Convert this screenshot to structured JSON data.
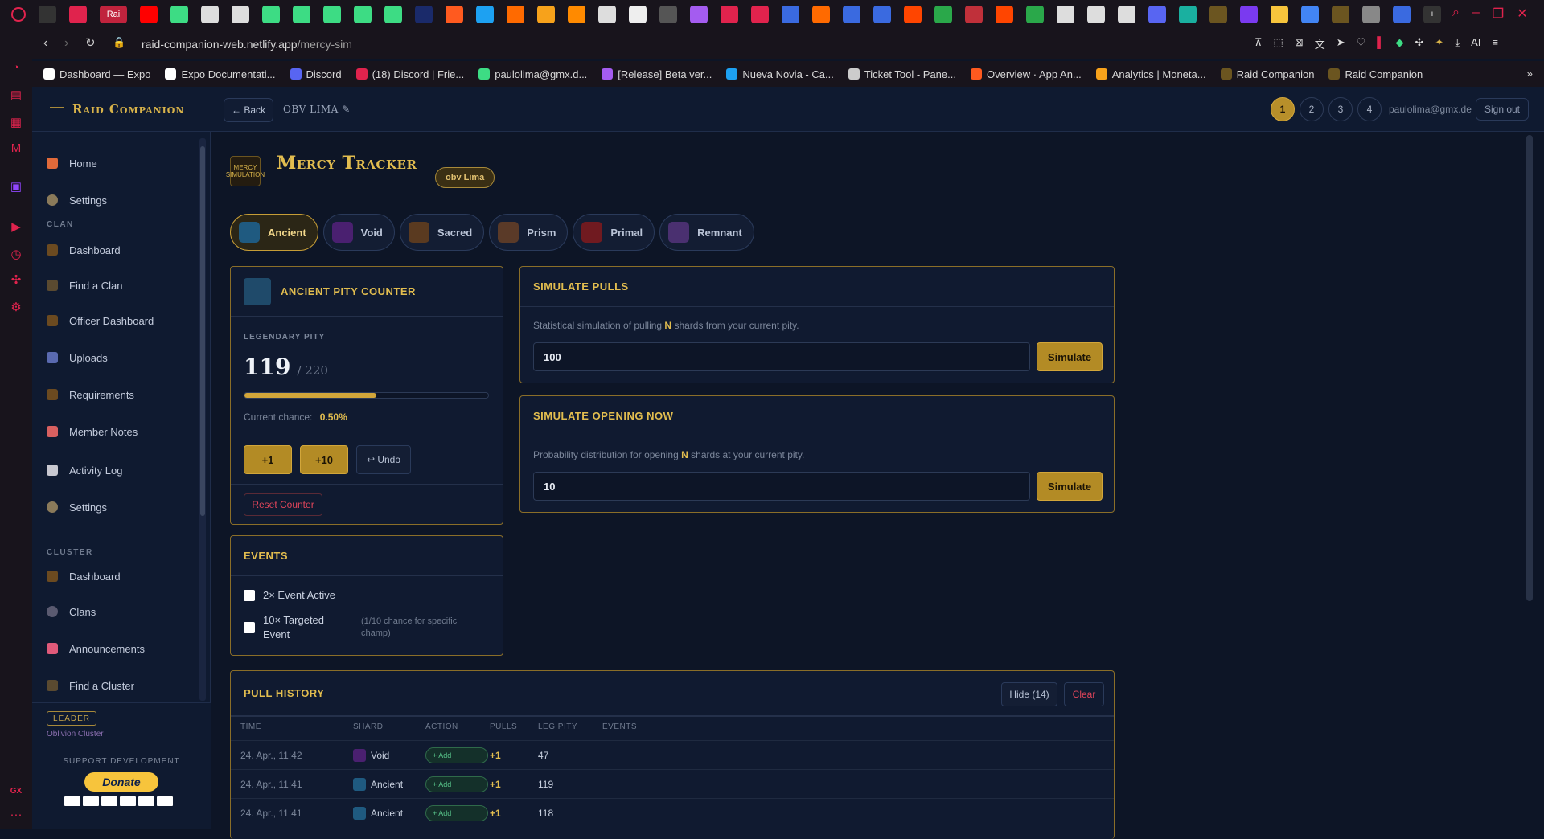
{
  "browser": {
    "url_host": "raid-companion-web.netlify.app",
    "url_path": "/mercy-sim",
    "bookmarks": [
      {
        "label": "Dashboard — Expo",
        "color": "#ffffff"
      },
      {
        "label": "Expo Documentati...",
        "color": "#ffffff"
      },
      {
        "label": "Discord",
        "color": "#5865f2"
      },
      {
        "label": "(18) Discord | Frie...",
        "color": "#e0234d"
      },
      {
        "label": "paulolima@gmx.d...",
        "color": "#3ddc84"
      },
      {
        "label": "[Release] Beta ver...",
        "color": "#a45cf0"
      },
      {
        "label": "Nueva Novia - Ca...",
        "color": "#1da1f2"
      },
      {
        "label": "Ticket Tool - Pane...",
        "color": "#cccccc"
      },
      {
        "label": "Overview · App An...",
        "color": "#ff5a1f"
      },
      {
        "label": "Analytics | Moneta...",
        "color": "#f7a21b"
      },
      {
        "label": "Raid Companion",
        "color": "#6b5520"
      },
      {
        "label": "Raid Companion",
        "color": "#6b5520"
      }
    ]
  },
  "app": {
    "brand": "Raid Companion",
    "back_label": "← Back",
    "account_name": "OBV LIMA ✎",
    "slots": [
      "1",
      "2",
      "3",
      "4"
    ],
    "active_slot": "1",
    "email": "paulolima@gmx.de",
    "sign_out": "Sign out"
  },
  "sidebar": {
    "top_items": [
      {
        "label": "Home",
        "icon": "home-icon",
        "color": "#e06a3a"
      },
      {
        "label": "Settings",
        "icon": "gear-icon",
        "color": "#8a7a5a"
      }
    ],
    "clan_title": "CLAN",
    "clan_items": [
      {
        "label": "Dashboard",
        "icon": "dashboard-icon",
        "color": "#6b4a20"
      },
      {
        "label": "Find a Clan",
        "icon": "search-icon",
        "color": "#5a4a30"
      },
      {
        "label": "Officer Dashboard",
        "icon": "shield-icon",
        "color": "#6b4a20"
      },
      {
        "label": "Uploads",
        "icon": "upload-icon",
        "color": "#5a6ab0"
      },
      {
        "label": "Requirements",
        "icon": "list-icon",
        "color": "#6b4a20"
      },
      {
        "label": "Member Notes",
        "icon": "note-icon",
        "color": "#d86060"
      },
      {
        "label": "Activity Log",
        "icon": "log-icon",
        "color": "#c8c8d0"
      },
      {
        "label": "Settings",
        "icon": "gear-icon",
        "color": "#8a7a5a"
      }
    ],
    "cluster_title": "CLUSTER",
    "cluster_items": [
      {
        "label": "Dashboard",
        "icon": "dashboard-icon",
        "color": "#6b4a20"
      },
      {
        "label": "Clans",
        "icon": "eye-icon",
        "color": "#5a5a70"
      },
      {
        "label": "Announcements",
        "icon": "megaphone-icon",
        "color": "#e05a7a"
      },
      {
        "label": "Find a Cluster",
        "icon": "search-icon",
        "color": "#5a4a30"
      }
    ],
    "leader_badge": "LEADER",
    "leader_clan": "Oblivion Cluster",
    "support_title": "SUPPORT DEVELOPMENT",
    "donate_label": "Donate"
  },
  "page": {
    "title": "Mercy Tracker",
    "logo_text": "MERCY SIMULATION",
    "account_badge": "obv Lima",
    "shard_tabs": [
      {
        "label": "Ancient",
        "color": "#3a8fc0",
        "active": true
      },
      {
        "label": "Void",
        "color": "#7a3ab0",
        "active": false
      },
      {
        "label": "Sacred",
        "color": "#c08a3a",
        "active": false
      },
      {
        "label": "Prism",
        "color": "#c07a3a",
        "active": false
      },
      {
        "label": "Primal",
        "color": "#c0303a",
        "active": false
      },
      {
        "label": "Remnant",
        "color": "#8a5ac0",
        "active": false
      }
    ]
  },
  "pity": {
    "title": "ANCIENT PITY COUNTER",
    "label": "LEGENDARY PITY",
    "current": "119",
    "max": "/ 220",
    "progress_fraction": 0.54,
    "chance_label": "Current chance:",
    "chance_value": "0.50%",
    "plus1": "+1",
    "plus10": "+10",
    "undo": "↩ Undo",
    "reset": "Reset Counter"
  },
  "events": {
    "title": "EVENTS",
    "event1": "2× Event Active",
    "event2": "10× Targeted Event",
    "event2_note": "(1/10 chance for specific champ)"
  },
  "sim_pulls": {
    "title": "SIMULATE PULLS",
    "desc_pre": "Statistical simulation of pulling",
    "desc_n": "N",
    "desc_post": "shards from your current pity.",
    "value": "100",
    "button": "Simulate"
  },
  "sim_open": {
    "title": "SIMULATE OPENING NOW",
    "desc_pre": "Probability distribution for opening",
    "desc_n": "N",
    "desc_post": "shards at your current pity.",
    "value": "10",
    "button": "Simulate"
  },
  "history": {
    "title": "PULL HISTORY",
    "hide_label": "Hide (14)",
    "clear_label": "Clear",
    "columns": [
      "TIME",
      "SHARD",
      "ACTION",
      "PULLS",
      "LEG PITY",
      "EVENTS"
    ],
    "rows": [
      {
        "time": "24. Apr., 11:42",
        "shard": "Void",
        "shard_color": "#7a3ab0",
        "action": "+ Add",
        "pulls": "+1",
        "pity": "47"
      },
      {
        "time": "24. Apr., 11:41",
        "shard": "Ancient",
        "shard_color": "#3a8fc0",
        "action": "+ Add",
        "pulls": "+1",
        "pity": "119"
      },
      {
        "time": "24. Apr., 11:41",
        "shard": "Ancient",
        "shard_color": "#3a8fc0",
        "action": "+ Add",
        "pulls": "+1",
        "pity": "118"
      }
    ]
  }
}
